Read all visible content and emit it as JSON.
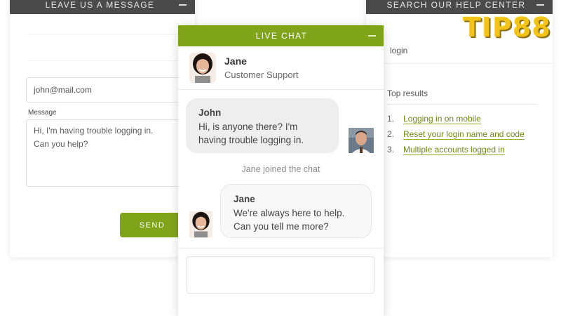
{
  "message_panel": {
    "title": "LEAVE US A MESSAGE",
    "email_value": "john@mail.com",
    "message_label": "Message",
    "message_lines": [
      "Hi, I'm having trouble logging in.",
      "Can you help?"
    ],
    "send_label": "SEND"
  },
  "live_chat": {
    "title": "LIVE CHAT",
    "agent": {
      "name": "Jane",
      "role": "Customer Support"
    },
    "messages": [
      {
        "sender": "John",
        "lines": [
          "Hi, is anyone there? I'm",
          "having trouble logging in."
        ]
      },
      {
        "sender": "Jane",
        "lines": [
          "We're always here to help.",
          "Can you tell me more?"
        ]
      }
    ],
    "system_message": "Jane joined the chat",
    "input_value": ""
  },
  "help_panel": {
    "title": "SEARCH OUR HELP CENTER",
    "search_value": "login",
    "results_heading": "Top results",
    "results": [
      {
        "num": "1.",
        "label": "Logging in on mobile"
      },
      {
        "num": "2.",
        "label": "Reset your login name and code"
      },
      {
        "num": "3.",
        "label": "Multiple accounts logged in"
      }
    ]
  },
  "logo": {
    "text": "TIP88"
  },
  "colors": {
    "accent_green": "#7fa41a",
    "link_green": "#6c8a12",
    "dark_header": "#4a4a4a",
    "logo_gold": "#f2c318"
  },
  "icons": [
    "minimize-icon",
    "agent-avatar",
    "user-avatar"
  ]
}
